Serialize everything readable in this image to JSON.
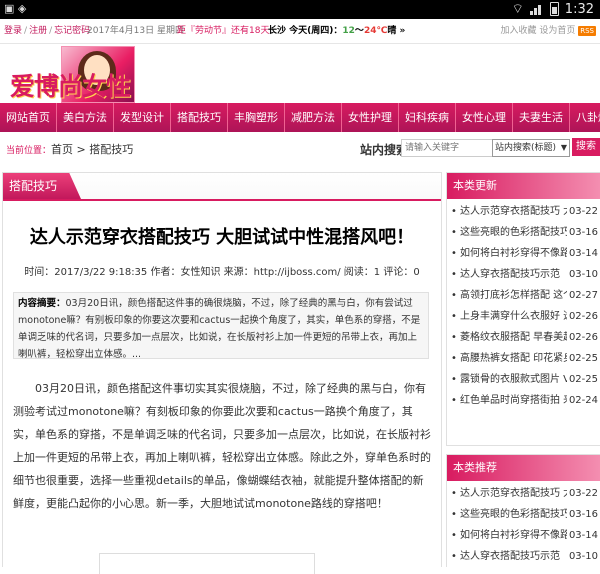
{
  "status_bar": {
    "time": "1:32"
  },
  "top_bar": {
    "login": "登录",
    "register": "注册",
    "forgot": "忘记密码",
    "date": "2017年4月13日 星期四",
    "countdown": "距『劳动节』还有18天",
    "weather_city": "长沙",
    "weather_label": "今天(周四)：",
    "weather_low": "12",
    "weather_sep": "～",
    "weather_high": "24℃",
    "weather_cond": "晴",
    "weather_arrow": "»",
    "favorite": "加入收藏",
    "homepage": "设为首页",
    "rss": "RSS"
  },
  "logo": {
    "text": "爱博尚女性"
  },
  "nav": {
    "items": [
      "网站首页",
      "美白方法",
      "发型设计",
      "搭配技巧",
      "丰胸塑形",
      "减肥方法",
      "女性护理",
      "妇科疾病",
      "女性心理",
      "夫妻生活",
      "八卦爆料"
    ]
  },
  "breadcrumb": {
    "label": "当前位置：",
    "home": "首页",
    "sep": " > ",
    "current": "搭配技巧"
  },
  "search": {
    "label": "站内搜索",
    "placeholder": "请输入关键字",
    "scope": "站内搜索(标题)",
    "button": "搜索"
  },
  "article": {
    "section": "搭配技巧",
    "title": "达人示范穿衣搭配技巧 大胆试试中性混搭风吧！",
    "meta": "时间：2017/3/22 9:18:35  作者：女性知识  来源：http://ijboss.com/  阅读：1  评论：0",
    "summary_label": "内容摘要：",
    "summary": "03月20日讯，颜色搭配这件事的确很烧脑，不过，除了经典的黑与白，你有尝试过monotone嘛？有别板印象的你要这次要和cactus一起换个角度了，其实，单色系的穿搭，不是单调乏味的代名词，只要多加一点层次，比如说，在长版衬衫上加一件更短的吊带上衣，再加上喇叭裤，轻松穿出立体感。...",
    "body": "03月20日讯，颜色搭配这件事切实其实很烧脑，不过，除了经典的黑与白，你有测验考试过monotone嘛？有刻板印象的你要此次要和cactus一路换个角度了，其实，单色系的穿搭，不是单调乏味的代名词，只要多加一点层次，比如说，在长版衬衫上加一件更短的吊带上衣，再加上喇叭裤，轻松穿出立体感。除此之外，穿单色系时的细节也很重要，选择一些重视details的单品，像蝴蝶结衣袖，就能提升整体搭配的新鲜度，更能凸起你的小心思。新一季，大胆地试试monotone路线的穿搭吧！"
  },
  "sidebar": {
    "latest": {
      "title": "本类更新",
      "items": [
        {
          "title": "达人示范穿衣搭配技巧 大胆",
          "date": "03-22"
        },
        {
          "title": "这些亮眼的色彩搭配技巧 明",
          "date": "03-16"
        },
        {
          "title": "如何将白衬衫穿得不像路人",
          "date": "03-14"
        },
        {
          "title": "达人穿衣搭配技巧示范",
          "date": "03-10"
        },
        {
          "title": "高领打底衫怎样搭配 这个秋",
          "date": "02-27"
        },
        {
          "title": "上身丰满穿什么衣服好 选宽",
          "date": "02-26"
        },
        {
          "title": "菱格纹衣服搭配 早春美起来",
          "date": "02-26"
        },
        {
          "title": "高腰热裤女搭配 印花紧身翻",
          "date": "02-25"
        },
        {
          "title": "露锁骨的衣服款式图片 V领",
          "date": "02-25"
        },
        {
          "title": "红色单品时尚穿搭街拍 来个",
          "date": "02-24"
        }
      ]
    },
    "recommend": {
      "title": "本类推荐",
      "items": [
        {
          "title": "达人示范穿衣搭配技巧 大胆",
          "date": "03-22"
        },
        {
          "title": "这些亮眼的色彩搭配技巧 明",
          "date": "03-16"
        },
        {
          "title": "如何将白衬衫穿得不像路人",
          "date": "03-14"
        },
        {
          "title": "达人穿衣搭配技巧示范",
          "date": "03-10"
        }
      ]
    }
  },
  "colors": {
    "accent": "#d81b60",
    "nav_bg": "#c2185b"
  }
}
